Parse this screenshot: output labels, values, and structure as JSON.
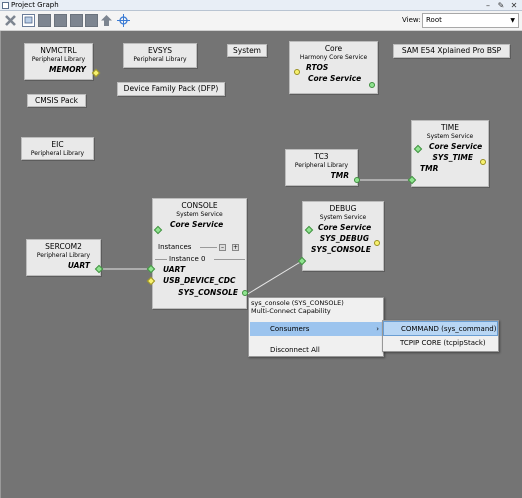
{
  "window": {
    "title": "Project Graph",
    "controls": [
      "–",
      "✎",
      "✕"
    ]
  },
  "toolbar": {
    "view_label": "View:",
    "view_value": "Root"
  },
  "colors": {
    "canvas": "#747474",
    "node": "#e9e9e9",
    "port_green": "#8fe38f",
    "port_yellow": "#f7f06e",
    "menu_highlight": "#9cc4ee"
  },
  "nodes": {
    "nvmctrl": {
      "name": "NVMCTRL",
      "sub": "Peripheral Library",
      "port": "MEMORY"
    },
    "evsys": {
      "name": "EVSYS",
      "sub": "Peripheral Library"
    },
    "system": {
      "name": "System"
    },
    "core": {
      "name": "Core",
      "sub": "Harmony Core Service",
      "port1": "RTOS",
      "port2": "Core Service"
    },
    "bsp": {
      "name": "SAM E54 Xplained Pro BSP"
    },
    "cmsis": {
      "name": "CMSIS Pack"
    },
    "dfp": {
      "name": "Device Family Pack (DFP)"
    },
    "eic": {
      "name": "EIC",
      "sub": "Peripheral Library"
    },
    "time": {
      "name": "TIME",
      "sub": "System Service",
      "port1": "Core Service",
      "port2": "SYS_TIME",
      "port3": "TMR"
    },
    "tc3": {
      "name": "TC3",
      "sub": "Peripheral Library",
      "port": "TMR"
    },
    "console": {
      "name": "CONSOLE",
      "sub": "System Service",
      "port1": "Core Service",
      "instances": "Instances",
      "instance0": "Instance 0",
      "p_uart": "UART",
      "p_usb": "USB_DEVICE_CDC",
      "p_sys": "SYS_CONSOLE"
    },
    "debug": {
      "name": "DEBUG",
      "sub": "System Service",
      "port1": "Core Service",
      "port2": "SYS_DEBUG",
      "port3": "SYS_CONSOLE"
    },
    "sercom2": {
      "name": "SERCOM2",
      "sub": "Peripheral Library",
      "port": "UART"
    }
  },
  "context_menu": {
    "header1": "sys_console (SYS_CONSOLE)",
    "header2": "Multi-Connect Capability",
    "consumers": "Consumers",
    "disconnect": "Disconnect All",
    "submenu": [
      "COMMAND (sys_command)",
      "TCPIP CORE (tcpipStack)"
    ]
  }
}
